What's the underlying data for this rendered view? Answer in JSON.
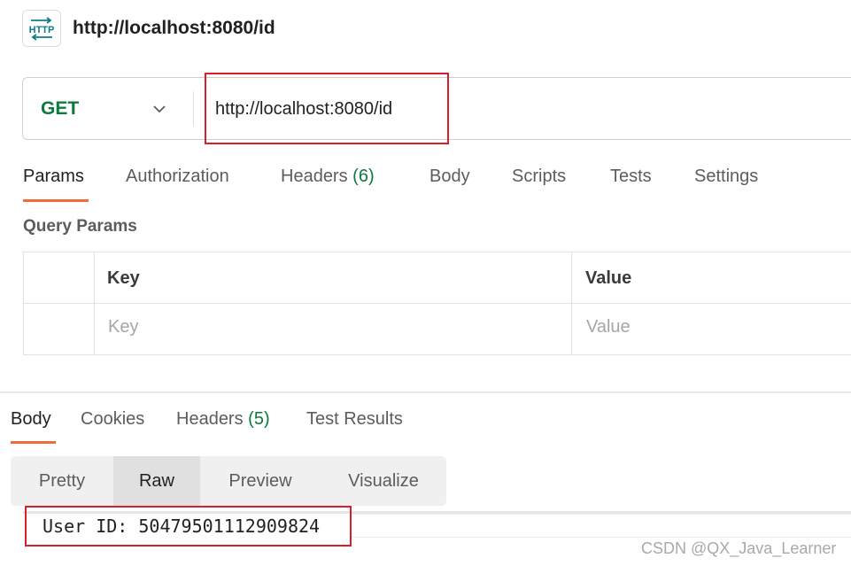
{
  "header": {
    "title": "http://localhost:8080/id",
    "icon": "http-icon"
  },
  "request": {
    "method": "GET",
    "url": "http://localhost:8080/id",
    "tabs": [
      {
        "label": "Params",
        "active": true
      },
      {
        "label": "Authorization"
      },
      {
        "label": "Headers",
        "count": "(6)"
      },
      {
        "label": "Body"
      },
      {
        "label": "Scripts"
      },
      {
        "label": "Tests"
      },
      {
        "label": "Settings"
      }
    ],
    "query_params": {
      "label": "Query Params",
      "columns": [
        "Key",
        "Value"
      ],
      "placeholders": {
        "key": "Key",
        "value": "Value"
      }
    }
  },
  "response": {
    "tabs": [
      {
        "label": "Body",
        "active": true
      },
      {
        "label": "Cookies"
      },
      {
        "label": "Headers",
        "count": "(5)"
      },
      {
        "label": "Test Results"
      }
    ],
    "modes": [
      "Pretty",
      "Raw",
      "Preview",
      "Visualize"
    ],
    "active_mode": "Raw",
    "body": "User ID: 50479501112909824"
  },
  "watermark": "CSDN @QX_Java_Learner",
  "colors": {
    "accent": "#f26b3a",
    "method_green": "#0b7a3d",
    "highlight_red": "#d6202a",
    "icon_teal": "#0e7c8a"
  }
}
